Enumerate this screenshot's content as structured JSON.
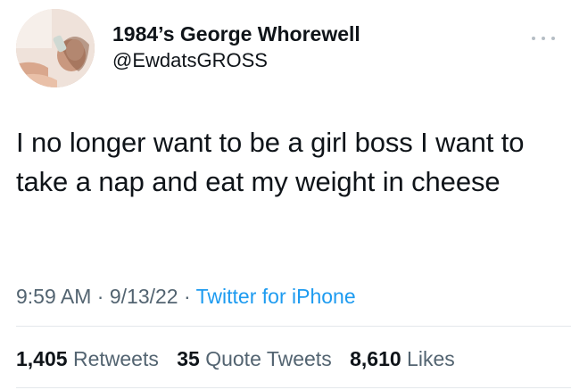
{
  "author": {
    "display_name": "1984’s George Whorewell",
    "handle": "@EwdatsGROSS"
  },
  "tweet": {
    "text": "I no longer want to be a girl boss I want to take a nap and eat my weight in cheese",
    "time": "9:59 AM",
    "date": "9/13/22",
    "source": "Twitter for iPhone",
    "separator": "·"
  },
  "stats": {
    "retweets": {
      "count": "1,405",
      "label": "Retweets"
    },
    "quote_tweets": {
      "count": "35",
      "label": "Quote Tweets"
    },
    "likes": {
      "count": "8,610",
      "label": "Likes"
    }
  },
  "icons": {
    "more": "more-horizontal-icon"
  },
  "colors": {
    "text_primary": "#0f1419",
    "text_secondary": "#536471",
    "link": "#1d9bf0",
    "divider": "#e4e8eb"
  }
}
